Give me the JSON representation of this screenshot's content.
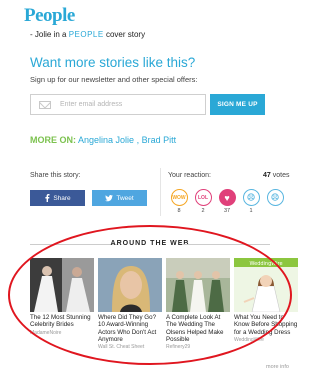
{
  "header": {
    "logo": "People"
  },
  "teaser": {
    "text": "- Jolie in a",
    "brand": "PEOPLE",
    "rest": "cover story"
  },
  "newsletter": {
    "headline": "Want more stories like this?",
    "subtext": "Sign up for our newsletter and other special offers:",
    "email_placeholder": "Enter email address",
    "signup_label": "SIGN ME UP"
  },
  "more_on": {
    "label": "MORE ON:",
    "tags": [
      "Angelina Jolie",
      "Brad Pitt"
    ],
    "separator": ","
  },
  "share": {
    "label": "Share this story:",
    "facebook_label": "Share",
    "twitter_label": "Tweet"
  },
  "reaction": {
    "label": "Your reaction:",
    "votes_count": "47",
    "votes_word": "votes",
    "items": [
      {
        "name": "wow",
        "symbol": "WOW",
        "count": "8"
      },
      {
        "name": "lol",
        "symbol": "LOL",
        "count": "2"
      },
      {
        "name": "love",
        "symbol": "♥",
        "count": "37"
      },
      {
        "name": "sad",
        "symbol": "☹",
        "count": "1"
      },
      {
        "name": "mad",
        "symbol": "☹",
        "count": ""
      }
    ]
  },
  "around_the_web": {
    "heading": "AROUND THE WEB",
    "cards": [
      {
        "title": "The 12 Most Stunning Celebrity Brides",
        "source": "MadameNoire"
      },
      {
        "title": "Where Did They Go? 10 Award-Winning Actors Who Don't Act Anymore",
        "source": "Wall St. Cheat Sheet"
      },
      {
        "title": "A Complete Look At The Wedding The Olsens Helped Make Possible",
        "source": "Refinery29"
      },
      {
        "title": "What You Need to Know Before Shopping for a Wedding Dress",
        "source": "WeddingWire"
      }
    ],
    "more_info": "more info"
  },
  "colors": {
    "brand_blue": "#2aa8d6",
    "more_on_green": "#7cc24f",
    "facebook": "#3b5998",
    "twitter": "#4fa6e0",
    "annotation_red": "#e0161f"
  },
  "icons": [
    "mail-icon",
    "facebook-icon",
    "twitter-icon"
  ]
}
